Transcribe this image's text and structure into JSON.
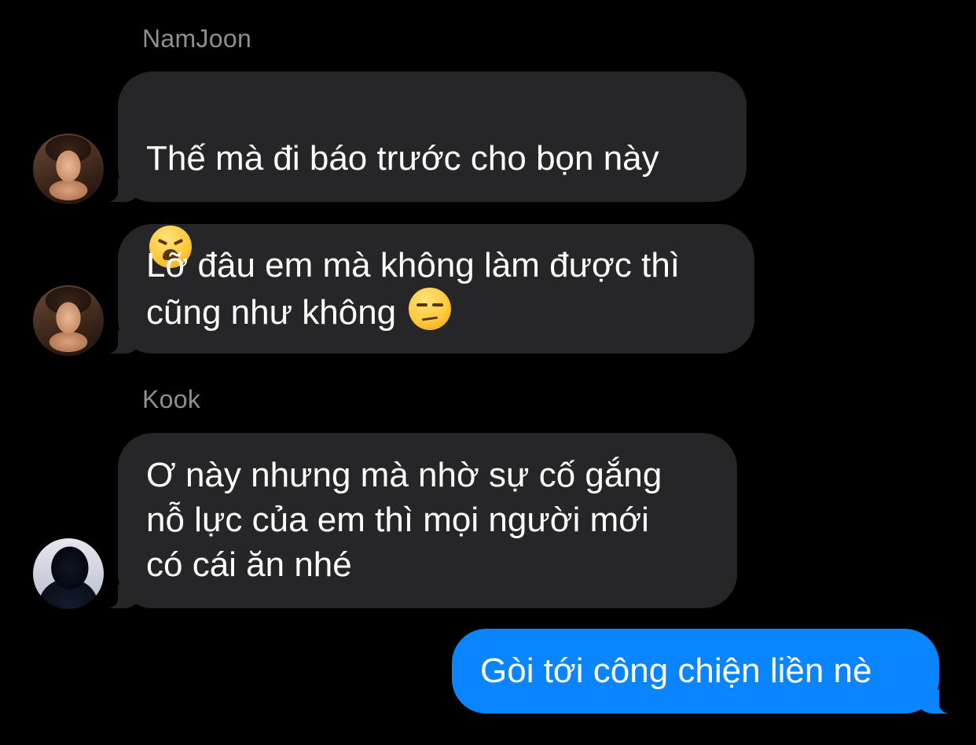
{
  "conversation": {
    "messages": [
      {
        "sender": "NamJoon",
        "text": "Thế mà đi báo trước cho bọn này",
        "emoji": "weary-face"
      },
      {
        "sender": "NamJoon",
        "text": "Lỡ đâu em mà không làm được thì\ncũng như không",
        "emoji": "unamused-face"
      },
      {
        "sender": "Kook",
        "text": "Ơ này nhưng mà nhờ sự cố gắng\nnỗ lực của em thì mọi người mới\ncó cái ăn nhé"
      },
      {
        "sender": "me",
        "text": "Gòi tới công chiện liền nè"
      }
    ]
  },
  "colors": {
    "background": "#000000",
    "incoming_bubble": "#262629",
    "outgoing_bubble": "#0a84ff",
    "sender_name": "#8e8e93",
    "text": "#ffffff"
  }
}
